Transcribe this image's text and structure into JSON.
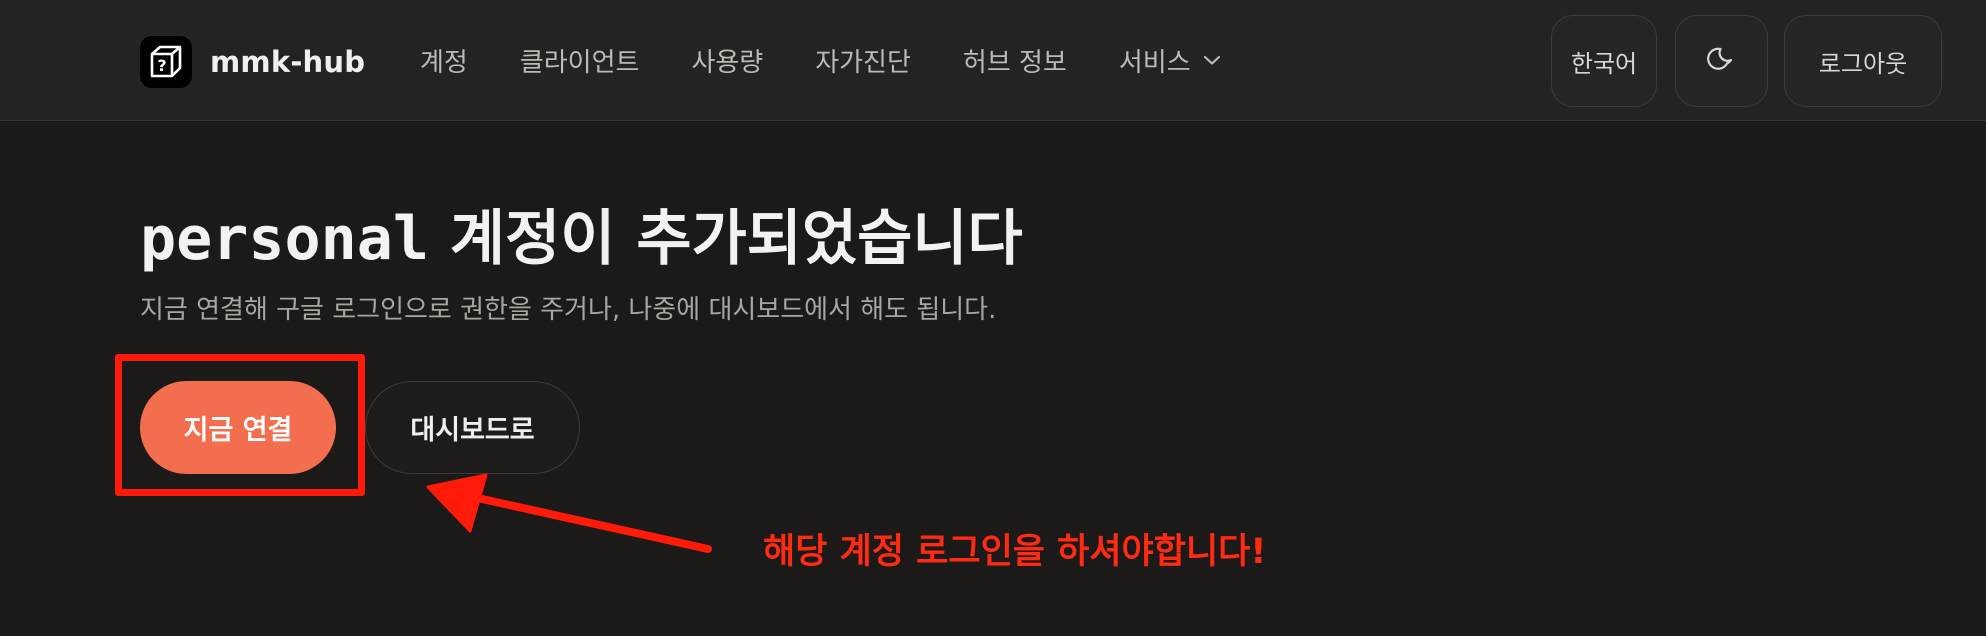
{
  "header": {
    "brand": {
      "name": "mmk-hub",
      "icon": "box-question-icon"
    },
    "nav": [
      {
        "label": "계정"
      },
      {
        "label": "클라이언트"
      },
      {
        "label": "사용량"
      },
      {
        "label": "자가진단"
      },
      {
        "label": "허브 정보"
      },
      {
        "label": "서비스",
        "has_dropdown": true
      }
    ],
    "language_label": "한국어",
    "theme_icon": "moon-icon",
    "logout_label": "로그아웃"
  },
  "main": {
    "title_account": "personal",
    "title_rest": " 계정이 추가되었습니다",
    "subtitle": "지금 연결해 구글 로그인으로 권한을 주거나, 나중에 대시보드에서 해도 됩니다.",
    "connect_label": "지금 연결",
    "dashboard_label": "대시보드로"
  },
  "annotation": {
    "text": "해당 계정 로그인을 하셔야합니다!"
  },
  "colors": {
    "background": "#1c1a18",
    "header_bg": "#242322",
    "accent": "#f26e4e",
    "annotation": "#ff1a0a"
  }
}
